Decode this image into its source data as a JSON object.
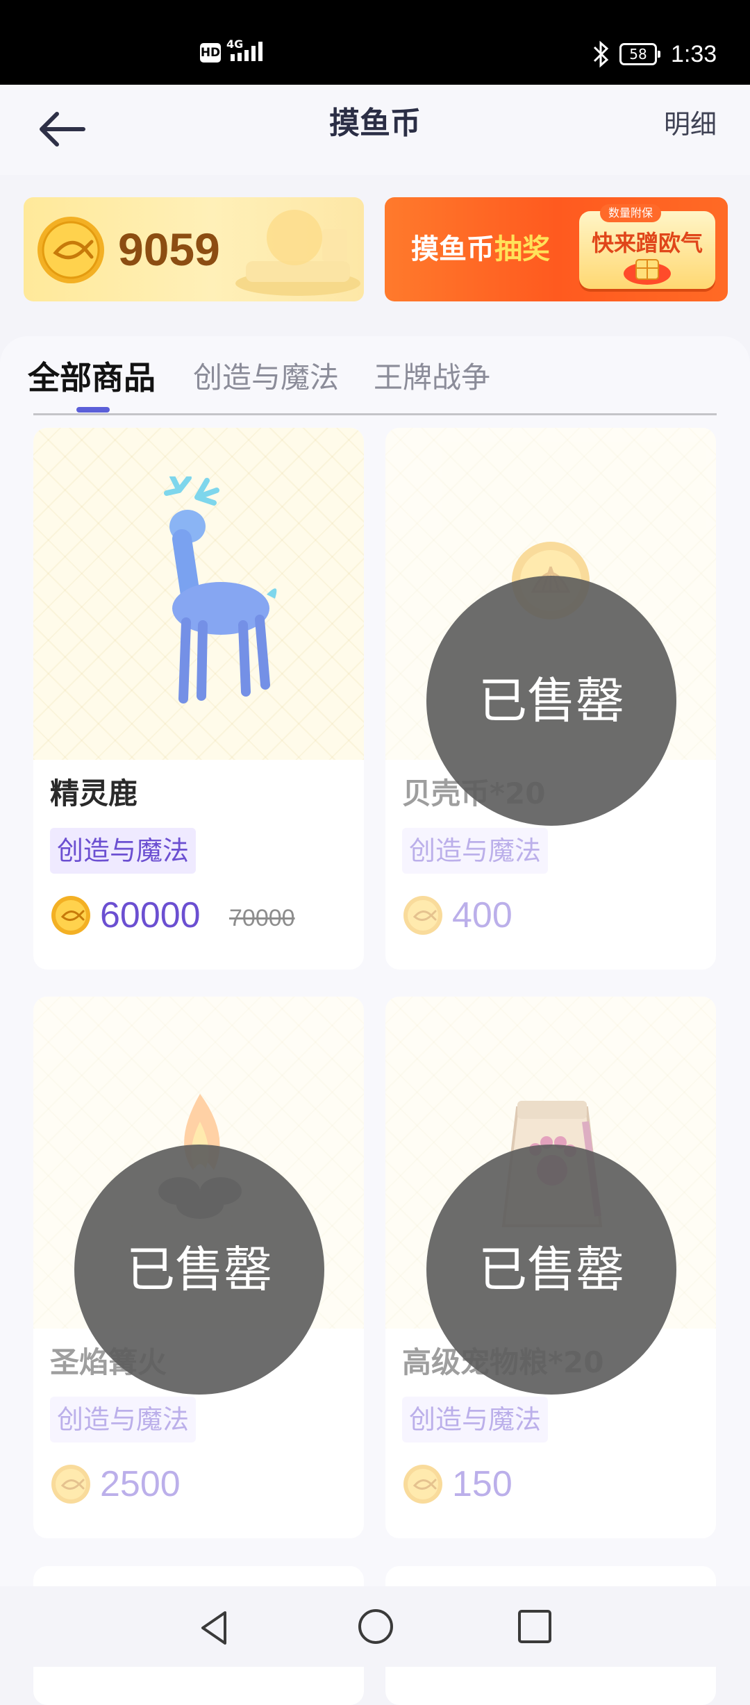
{
  "status_bar": {
    "hd": "HD",
    "network": "4G",
    "battery": "58",
    "time": "1:33"
  },
  "header": {
    "title": "摸鱼币",
    "detail_label": "明细"
  },
  "balance": {
    "value": "9059"
  },
  "lottery_banner": {
    "text_prefix": "摸鱼币",
    "text_highlight": "抽奖",
    "badge_tag": "数量附保",
    "badge_text": "快来蹭欧气"
  },
  "tabs": [
    {
      "label": "全部商品",
      "active": true
    },
    {
      "label": "创造与魔法",
      "active": false
    },
    {
      "label": "王牌战争",
      "active": false
    }
  ],
  "products": [
    {
      "name": "精灵鹿",
      "tag": "创造与魔法",
      "price": "60000",
      "old_price": "70000",
      "sold_out": false,
      "icon": "deer-icon"
    },
    {
      "name": "贝壳币*20",
      "tag": "创造与魔法",
      "price": "400",
      "sold_out": true,
      "icon": "shell-coin-icon"
    },
    {
      "name": "圣焰篝火",
      "tag": "创造与魔法",
      "price": "2500",
      "sold_out": true,
      "icon": "bonfire-icon"
    },
    {
      "name": "高级宠物粮*20",
      "tag": "创造与魔法",
      "price": "150",
      "sold_out": true,
      "icon": "pet-food-bag-icon"
    }
  ],
  "sold_out_label": "已售罄",
  "colors": {
    "accent": "#6b4fd1",
    "tab_indicator": "#5b5fd8",
    "overlay": "#5c5c5c",
    "banner_orange": "#ff5a1f"
  }
}
